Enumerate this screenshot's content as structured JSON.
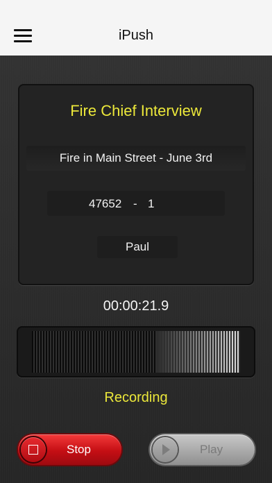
{
  "nav": {
    "title": "iPush"
  },
  "card": {
    "title": "Fire Chief Interview",
    "description": "Fire in Main Street - June 3rd",
    "job_number": "47652",
    "separator": "-",
    "sequence": "1",
    "author": "Paul"
  },
  "timer": "00:00:21.9",
  "meter": {
    "level": 0.6
  },
  "status": "Recording",
  "controls": {
    "stop_label": "Stop",
    "play_label": "Play"
  },
  "colors": {
    "accent_yellow": "#ece83a",
    "stop_red": "#d4151b",
    "play_grey": "#a9a9a9"
  }
}
